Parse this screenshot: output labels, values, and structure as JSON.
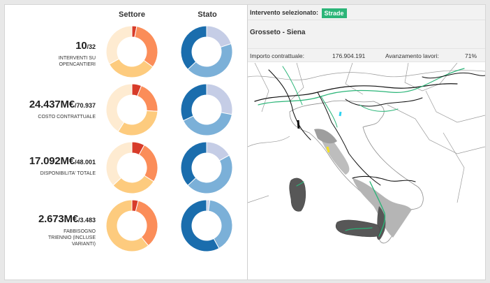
{
  "columns": {
    "settore": "Settore",
    "stato": "Stato"
  },
  "metrics": [
    {
      "value": "10",
      "total": "/32",
      "label": "INTERVENTI SU OPENCANTIERI",
      "settore": [
        0.03,
        0.32,
        0.32,
        0.33
      ],
      "stato": [
        0.2,
        0.43,
        0.37
      ]
    },
    {
      "value": "24.437M€",
      "total": "/70.937",
      "label": "COSTO CONTRATTUALE",
      "settore": [
        0.06,
        0.2,
        0.33,
        0.41
      ],
      "stato": [
        0.28,
        0.4,
        0.32
      ]
    },
    {
      "value": "17.092M€",
      "total": "/48.001",
      "label": "DISPONIBILITA' TOTALE",
      "settore": [
        0.08,
        0.26,
        0.29,
        0.37
      ],
      "stato": [
        0.17,
        0.46,
        0.37
      ]
    },
    {
      "value": "2.673M€",
      "total": "/3.483",
      "label": "FABBISOGNO TRIENNIO (INCLUSE VARIANTI)",
      "settore": [
        0.04,
        0.35,
        0.61,
        0.0
      ],
      "stato": [
        0.02,
        0.4,
        0.58
      ]
    }
  ],
  "palette": {
    "settore": [
      "#d73b29",
      "#fb8d59",
      "#fdcb7e",
      "#feebd1"
    ],
    "stato": [
      "#c5cde6",
      "#7bb0d8",
      "#1a6dad"
    ]
  },
  "panel": {
    "selected_label": "Intervento selezionato:",
    "selected_badge": "Strade",
    "route": "Grosseto - Siena",
    "importo_label": "Importo contrattuale:",
    "importo_value": "176.904.191",
    "avanzamento_label": "Avanzamento lavori:",
    "avanzamento_value": "71%"
  },
  "map": {
    "sea": "#ffffff",
    "land_outline": "#9a9a9a",
    "region_light": "#b5b5b5",
    "region_dark": "#575757",
    "road_green": "#2bb578",
    "road_black": "#111111",
    "highlight_yellow": "#f5e21b",
    "highlight_cyan": "#2fd2f0"
  }
}
